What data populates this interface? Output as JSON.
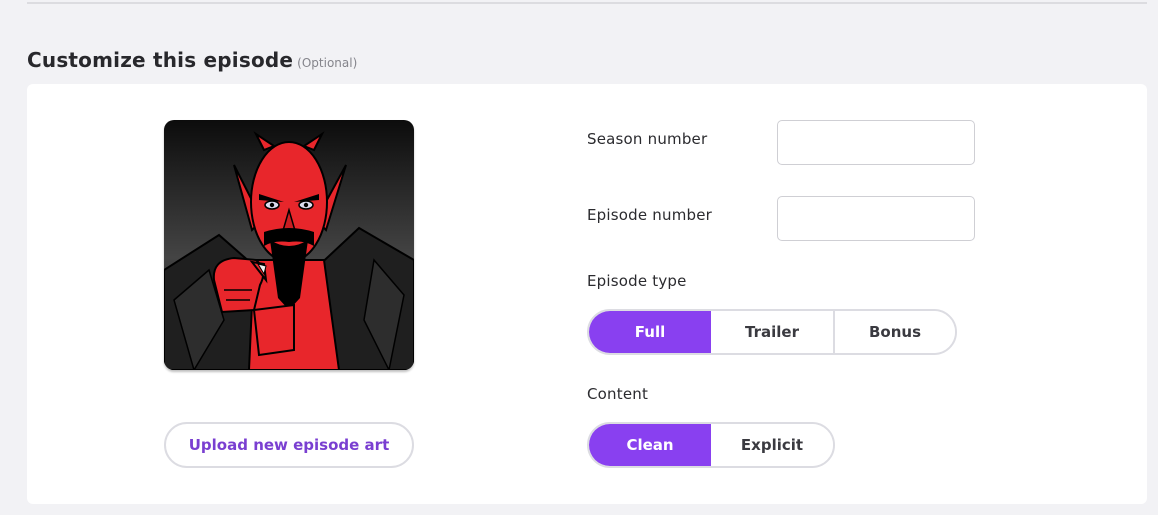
{
  "section": {
    "title": "Customize this episode",
    "optional_label": "(Optional)"
  },
  "episode_art": {
    "icon": "devil-illustration-icon"
  },
  "upload_button": {
    "label": "Upload new episode art"
  },
  "season": {
    "label": "Season number",
    "value": ""
  },
  "episode": {
    "label": "Episode number",
    "value": ""
  },
  "episode_type": {
    "label": "Episode type",
    "options": [
      "Full",
      "Trailer",
      "Bonus"
    ],
    "selected": "Full"
  },
  "content": {
    "label": "Content",
    "options": [
      "Clean",
      "Explicit"
    ],
    "selected": "Clean"
  },
  "colors": {
    "accent": "#8940f0",
    "link": "#7a3fd1",
    "page_background": "#f2f2f5",
    "card_background": "#ffffff"
  }
}
